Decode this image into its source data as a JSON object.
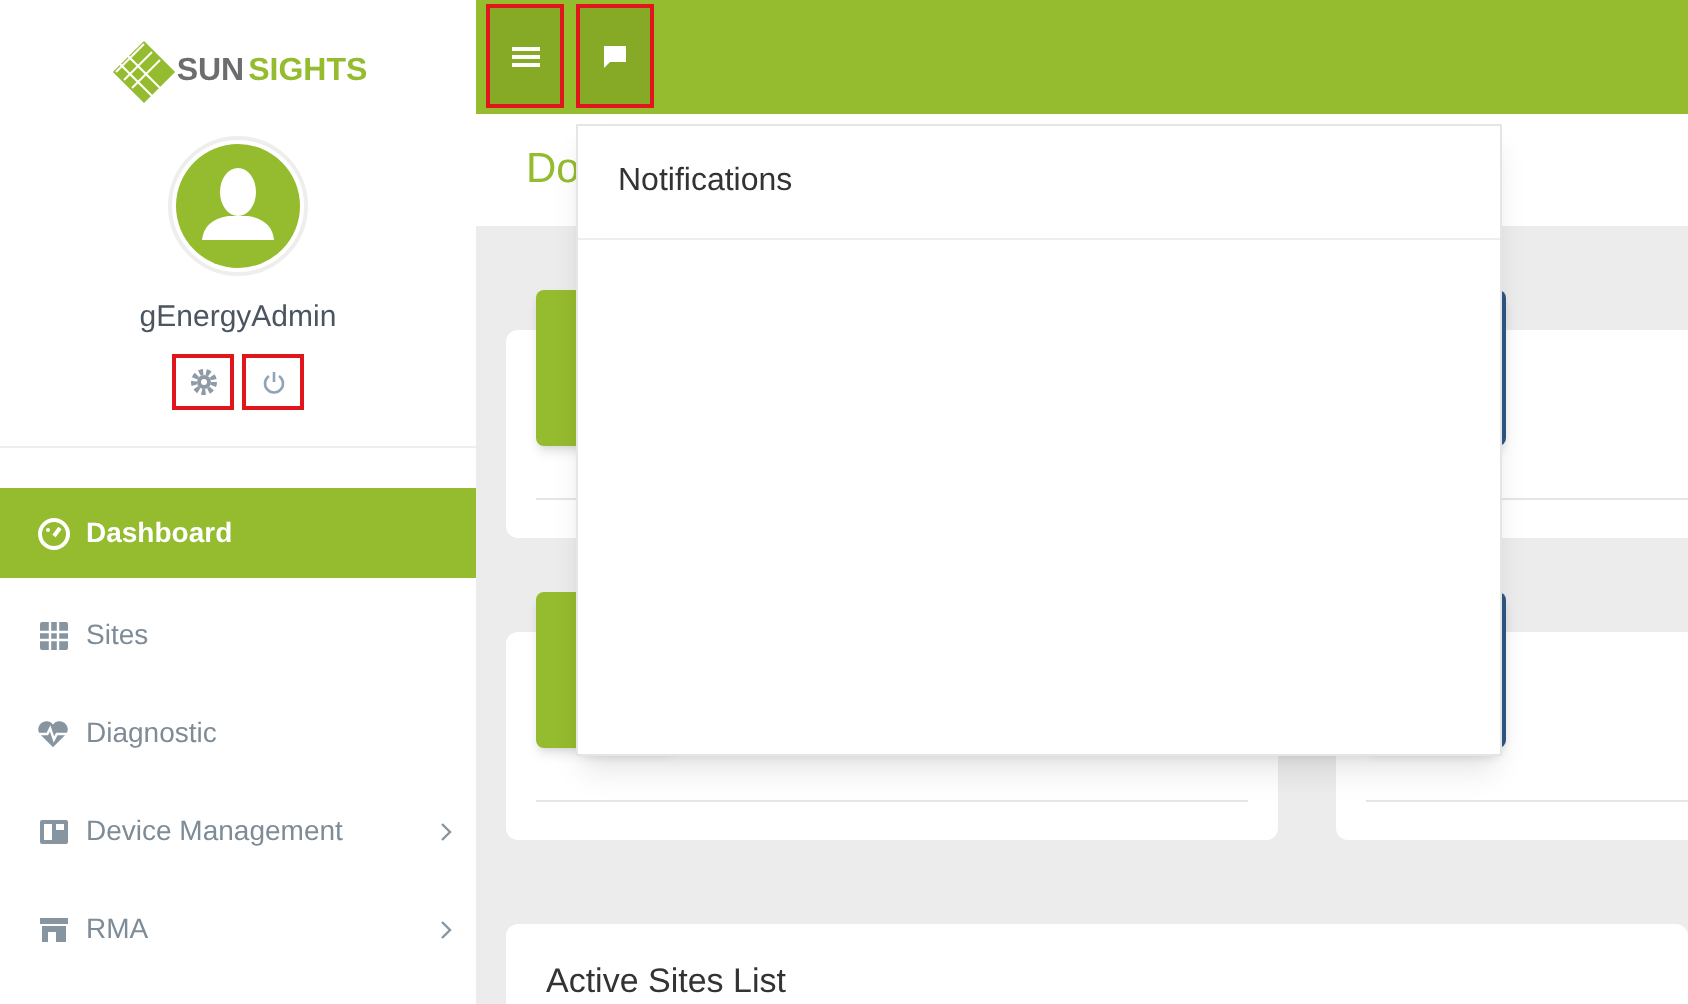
{
  "sidebar": {
    "logo": {
      "part_1": "SUN",
      "part_2": "SIGHTS"
    },
    "user": {
      "name": "gEnergyAdmin"
    },
    "user_actions": [
      {
        "kind": "settings",
        "highlighted": true
      },
      {
        "kind": "power",
        "highlighted": true
      }
    ],
    "items": [
      {
        "label": "Dashboard",
        "selected": true,
        "has_submenu": false
      },
      {
        "label": "Sites",
        "selected": false,
        "has_submenu": false
      },
      {
        "label": "Diagnostic",
        "selected": false,
        "has_submenu": false
      },
      {
        "label": "Device Management",
        "selected": false,
        "has_submenu": true
      },
      {
        "label": "RMA",
        "selected": false,
        "has_submenu": true
      }
    ]
  },
  "top_bar": {
    "buttons": [
      {
        "kind": "menu",
        "highlighted": true
      },
      {
        "kind": "chat",
        "highlighted": true
      }
    ]
  },
  "page_title": "Do",
  "stat_cards": [
    {
      "color": "#95bb2e"
    },
    {
      "color": "#2f5783"
    },
    {
      "color": "#95bb2e"
    },
    {
      "color": "#2f5783"
    }
  ],
  "sites_card": {
    "title": "Active Sites List"
  },
  "notifications_popup": {
    "title": "Notifications"
  }
}
